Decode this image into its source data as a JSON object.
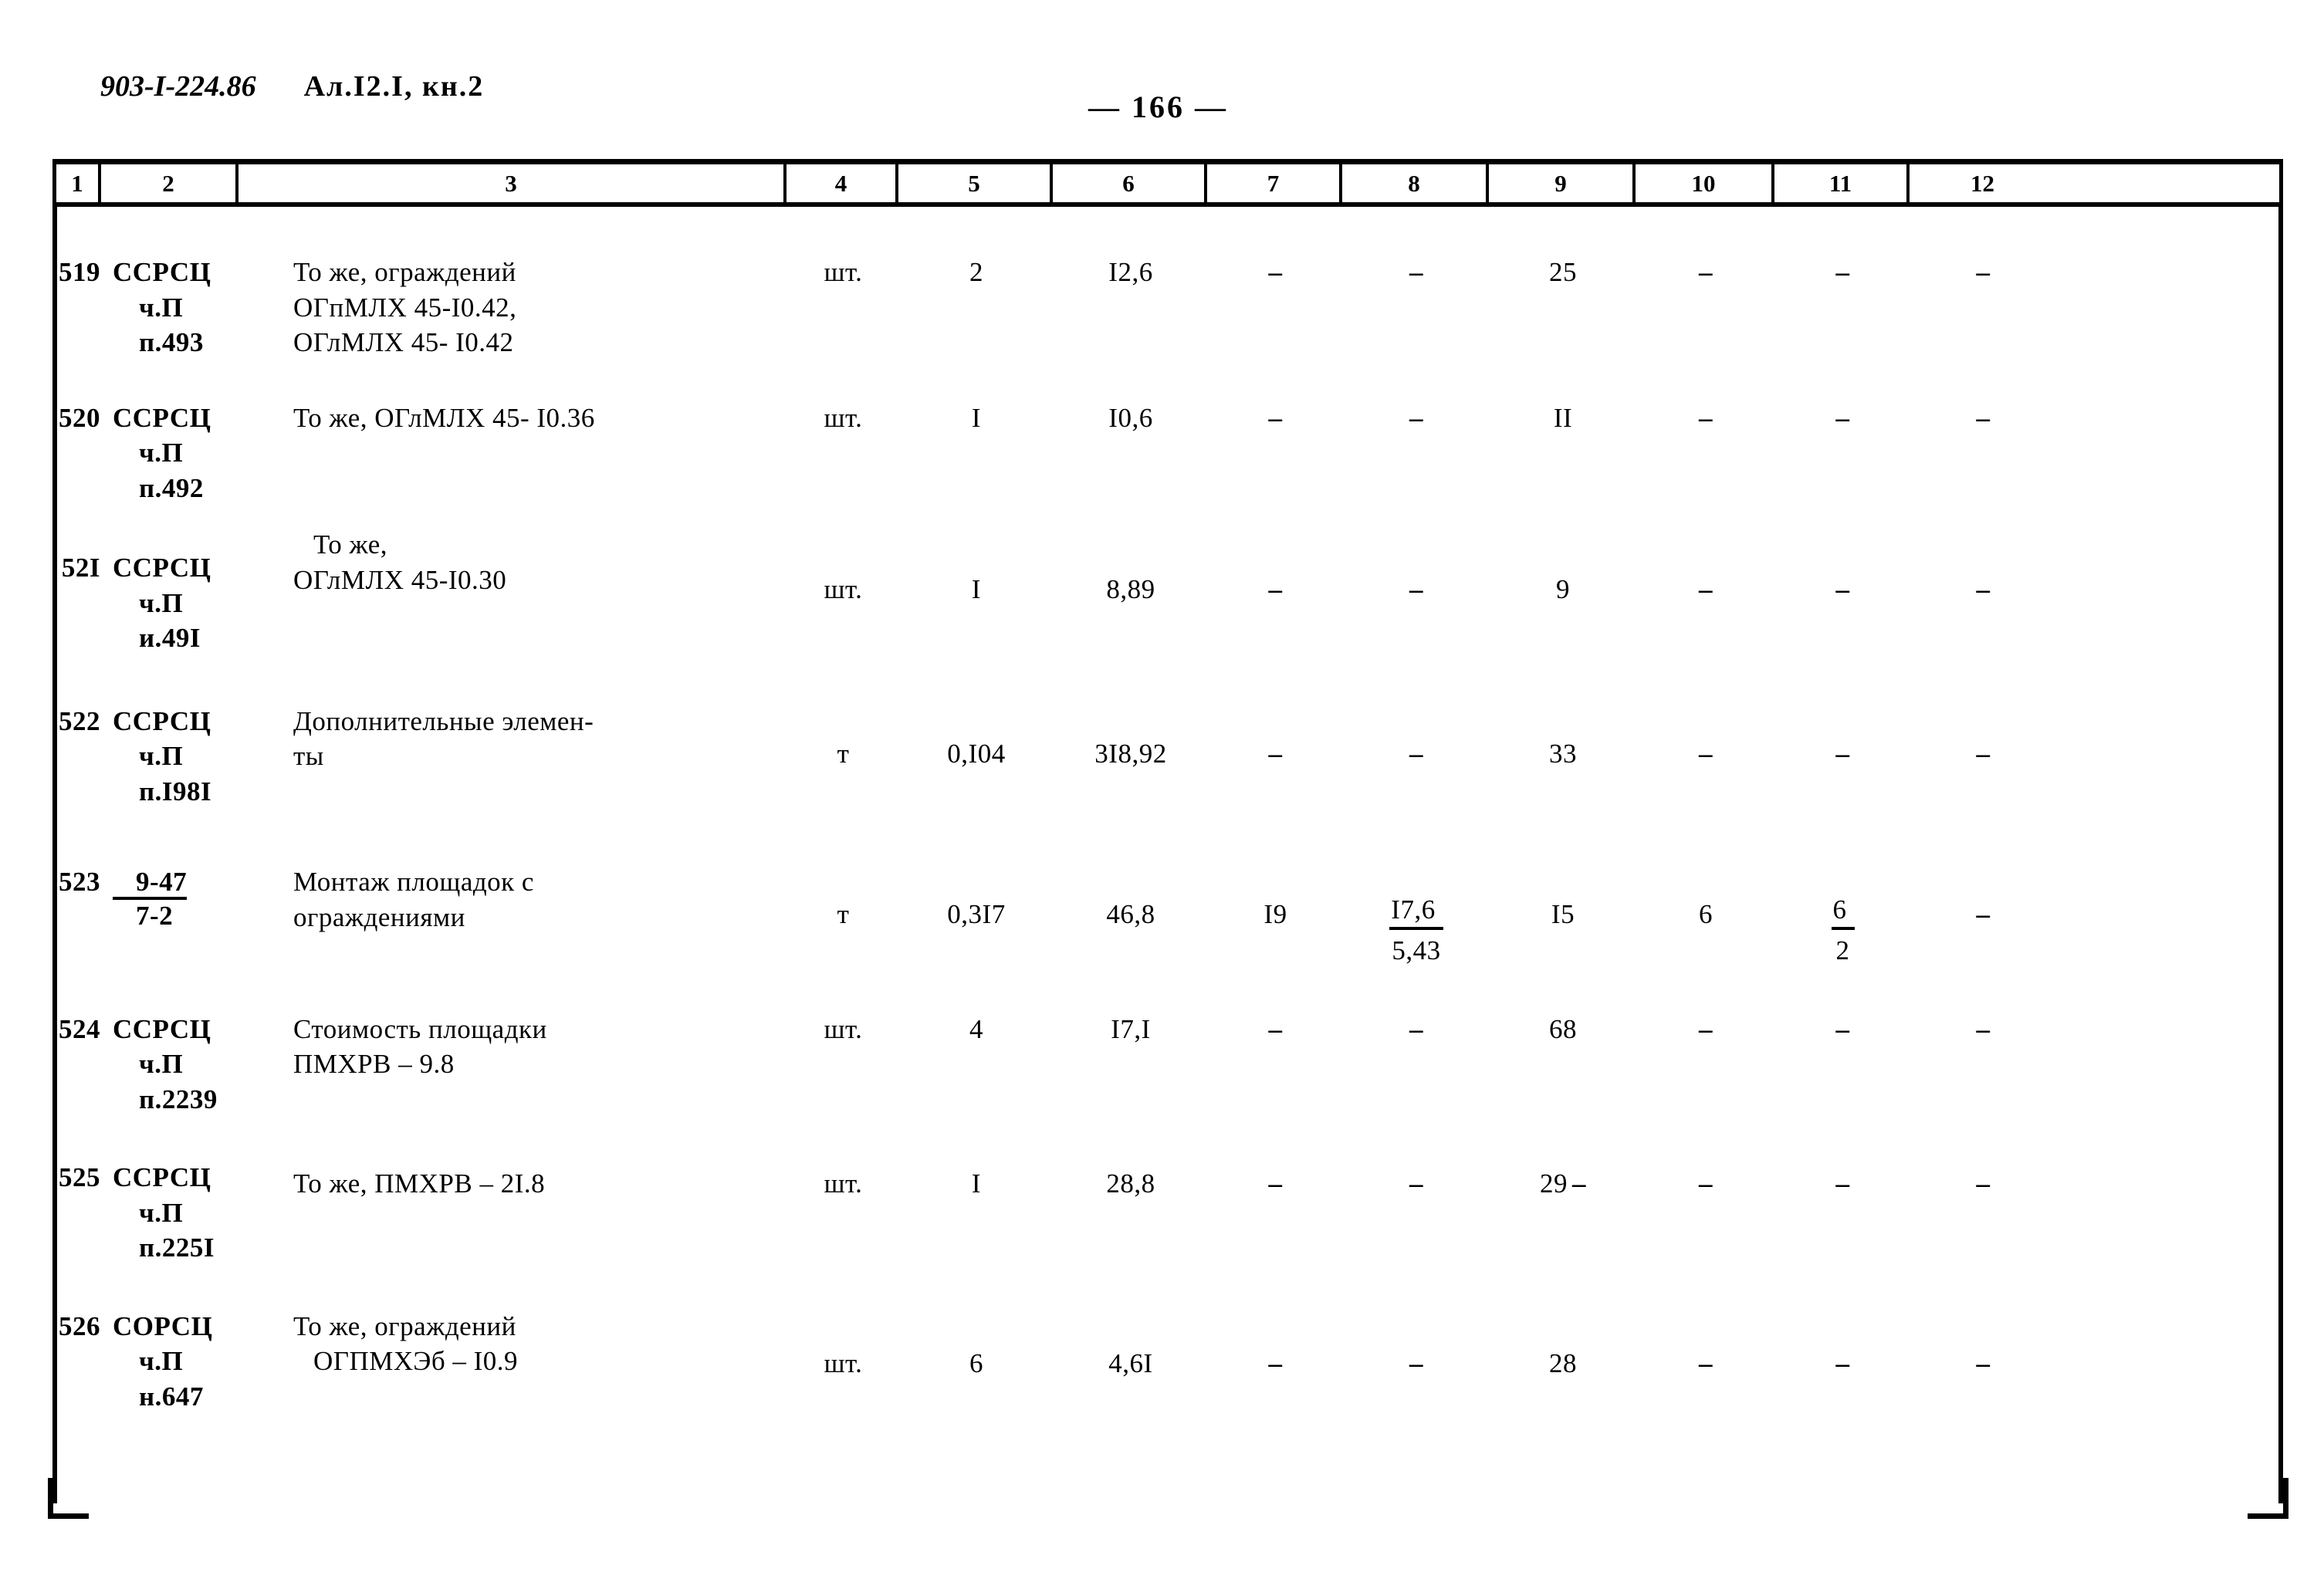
{
  "header": {
    "doc_code": "903-I-224.86",
    "album": "Ал.I2.I, кн.2",
    "page_number": "— 166 —"
  },
  "table": {
    "column_numbers": [
      "1",
      "2",
      "3",
      "4",
      "5",
      "6",
      "7",
      "8",
      "9",
      "10",
      "11",
      "12"
    ],
    "rows": [
      {
        "num": "519",
        "code_l1": "ССРСЦ",
        "code_l2": "ч.П",
        "code_l3": "п.493",
        "desc_1": "То же, ограждений",
        "desc_2": "ОГпМЛХ 45-I0.42,",
        "desc_3": "ОГлМЛХ 45- I0.42",
        "unit": "шт.",
        "c5": "2",
        "c6": "I2,6",
        "c7": "–",
        "c8": "–",
        "c9": "25",
        "c10": "–",
        "c11": "–",
        "c12": "–"
      },
      {
        "num": "520",
        "code_l1": "ССРСЦ",
        "code_l2": "ч.П",
        "code_l3": "п.492",
        "desc_1": "То же, ОГлМЛХ 45- I0.36",
        "desc_2": "",
        "desc_3": "",
        "unit": "шт.",
        "c5": "I",
        "c6": "I0,6",
        "c7": "–",
        "c8": "–",
        "c9": "II",
        "c10": "–",
        "c11": "–",
        "c12": "–"
      },
      {
        "num": "52I",
        "code_l1": "ССРСЦ",
        "code_l2": "ч.П",
        "code_l3": "и.49I",
        "desc_1": "То же,",
        "desc_2": "ОГлМЛХ 45-I0.30",
        "desc_3": "",
        "unit": "шт.",
        "c5": "I",
        "c6": "8,89",
        "c7": "–",
        "c8": "–",
        "c9": "9",
        "c10": "–",
        "c11": "–",
        "c12": "–"
      },
      {
        "num": "522",
        "code_l1": "ССРСЦ",
        "code_l2": "ч.П",
        "code_l3": "п.I98I",
        "desc_1": "Дополнительные элемен-",
        "desc_2": "ты",
        "desc_3": "",
        "unit": "т",
        "c5": "0,I04",
        "c6": "3I8,92",
        "c7": "–",
        "c8": "–",
        "c9": "33",
        "c10": "–",
        "c11": "–",
        "c12": "–"
      },
      {
        "num": "523",
        "code_frac_top": "9-47",
        "code_frac_bot": "7-2",
        "desc_1": "Монтаж площадок с",
        "desc_2": "ограждениями",
        "desc_3": "",
        "unit": "т",
        "c5": "0,3I7",
        "c6": "46,8",
        "c7": "I9",
        "c8_top": "I7,6",
        "c8_bot": "5,43",
        "c9": "I5",
        "c10": "6",
        "c11_top": "6",
        "c11_bot": "2",
        "c12": "–"
      },
      {
        "num": "524",
        "code_l1": "ССРСЦ",
        "code_l2": "ч.П",
        "code_l3": "п.2239",
        "desc_1": "Стоимость площадки",
        "desc_2": "ПМХРВ – 9.8",
        "desc_3": "",
        "unit": "шт.",
        "c5": "4",
        "c6": "I7,I",
        "c7": "–",
        "c8": "–",
        "c9": "68",
        "c10": "–",
        "c11": "–",
        "c12": "–"
      },
      {
        "num": "525",
        "code_l1": "ССРСЦ",
        "code_l2": "ч.П",
        "code_l3": "п.225I",
        "desc_1": "То же, ПМХРВ – 2I.8",
        "desc_2": "",
        "desc_3": "",
        "unit": "шт.",
        "c5": "I",
        "c6": "28,8",
        "c7": "–",
        "c8": "–",
        "c9": "29",
        "c9_trailing": "–",
        "c10": "–",
        "c11": "–",
        "c12": "–"
      },
      {
        "num": "526",
        "code_l1": "СОРСЦ",
        "code_l2": "ч.П",
        "code_l3": "н.647",
        "desc_1": "То же, ограждений",
        "desc_2": "ОГПМХЭб – I0.9",
        "desc_3": "",
        "unit": "шт.",
        "c5": "6",
        "c6": "4,6I",
        "c7": "–",
        "c8": "–",
        "c9": "28",
        "c10": "–",
        "c11": "–",
        "c12": "–"
      }
    ]
  }
}
